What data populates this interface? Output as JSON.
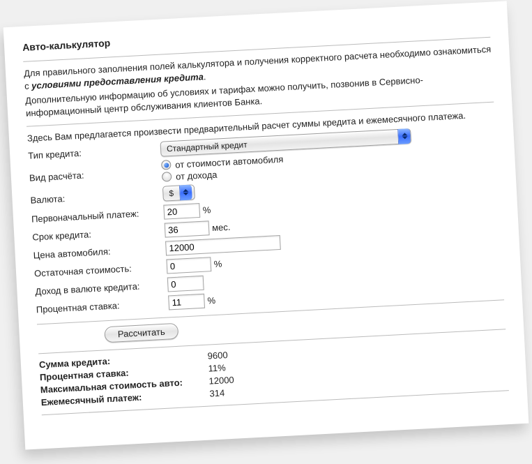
{
  "title": "Авто-калькулятор",
  "intro": {
    "line1_a": "Для правильного заполнения полей калькулятора и получения корректного расчета необходимо ознакомиться с ",
    "line1_emph": "условиями предоставления кредита",
    "line1_b": ".",
    "line2": "Дополнительную информацию об условиях и тарифах можно получить, позвонив в Сервисно-информационный центр обслуживания клиентов Банка.",
    "line3": "Здесь Вам предлагается произвести предварительный расчет суммы кредита и ежемесячного платежа."
  },
  "form": {
    "credit_type": {
      "label": "Тип кредита:",
      "value": "Стандартный кредит"
    },
    "calc_type": {
      "label": "Вид расчёта:",
      "opt1": "от стоимости автомобиля",
      "opt2": "от дохода",
      "selected": 0
    },
    "currency": {
      "label": "Валюта:",
      "value": "$"
    },
    "down_payment": {
      "label": "Первоначальный платеж:",
      "value": "20",
      "unit": "%"
    },
    "term": {
      "label": "Срок кредита:",
      "value": "36",
      "unit": "мес."
    },
    "car_price": {
      "label": "Цена автомобиля:",
      "value": "12000"
    },
    "residual": {
      "label": "Остаточная стоимость:",
      "value": "0",
      "unit": "%"
    },
    "income": {
      "label": "Доход в валюте кредита:",
      "value": "0"
    },
    "rate": {
      "label": "Процентная ставка:",
      "value": "11",
      "unit": "%"
    },
    "submit": "Рассчитать"
  },
  "results": {
    "credit_sum": {
      "label": "Сумма кредита:",
      "value": "9600"
    },
    "rate": {
      "label": "Процентная ставка:",
      "value": "11%"
    },
    "max_car": {
      "label": "Максимальная стоимость авто:",
      "value": "12000"
    },
    "monthly": {
      "label": "Ежемесячный платеж:",
      "value": "314"
    }
  }
}
